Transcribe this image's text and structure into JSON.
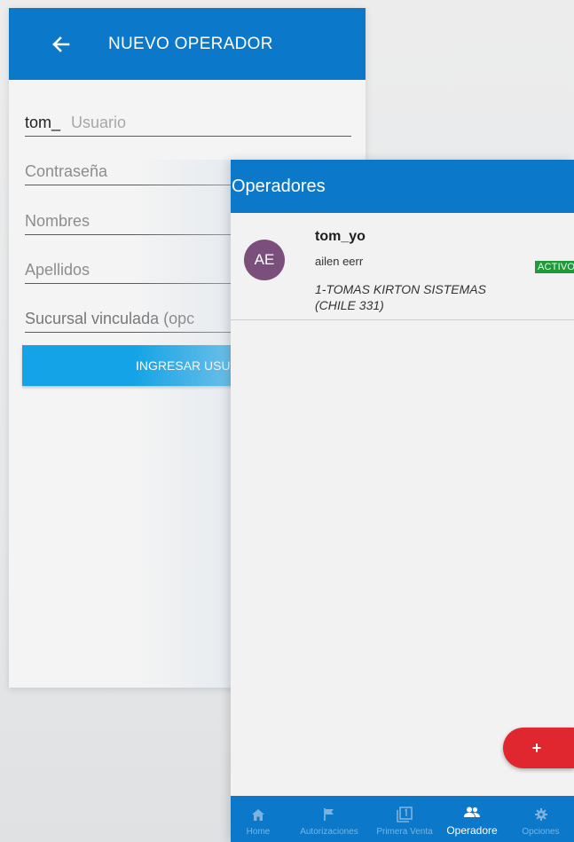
{
  "new_operator": {
    "title": "NUEVO OPERADOR",
    "usuario_value": "tom_",
    "usuario_placeholder": "Usuario",
    "password_placeholder": "Contraseña",
    "nombres_placeholder": "Nombres",
    "apellidos_placeholder": "Apellidos",
    "sucursal_placeholder": "Sucursal vinculada (opc",
    "submit_label": "INGRESAR USUA"
  },
  "operators_list": {
    "title": "Operadores",
    "items": [
      {
        "initials": "AE",
        "username": "tom_yo",
        "name": "ailen eerr",
        "branch": "1-TOMAS KIRTON SISTEMAS (CHILE 331)",
        "status": "ACTIVO"
      }
    ],
    "fab_label": "+"
  },
  "bottom_nav": {
    "items": [
      {
        "label": "Home",
        "icon": "home-icon"
      },
      {
        "label": "Autorizaciones",
        "icon": "flag-icon"
      },
      {
        "label": "Primera Venta",
        "icon": "first-sale-icon"
      },
      {
        "label": "Operadore",
        "icon": "people-icon",
        "active": true
      },
      {
        "label": "Opciones",
        "icon": "gear-icon"
      }
    ]
  },
  "colors": {
    "primary": "#0b78c9",
    "button": "#13a3e6",
    "fab": "#e0262f",
    "avatar": "#7b4f7b",
    "status_active": "#1f9a3a"
  }
}
